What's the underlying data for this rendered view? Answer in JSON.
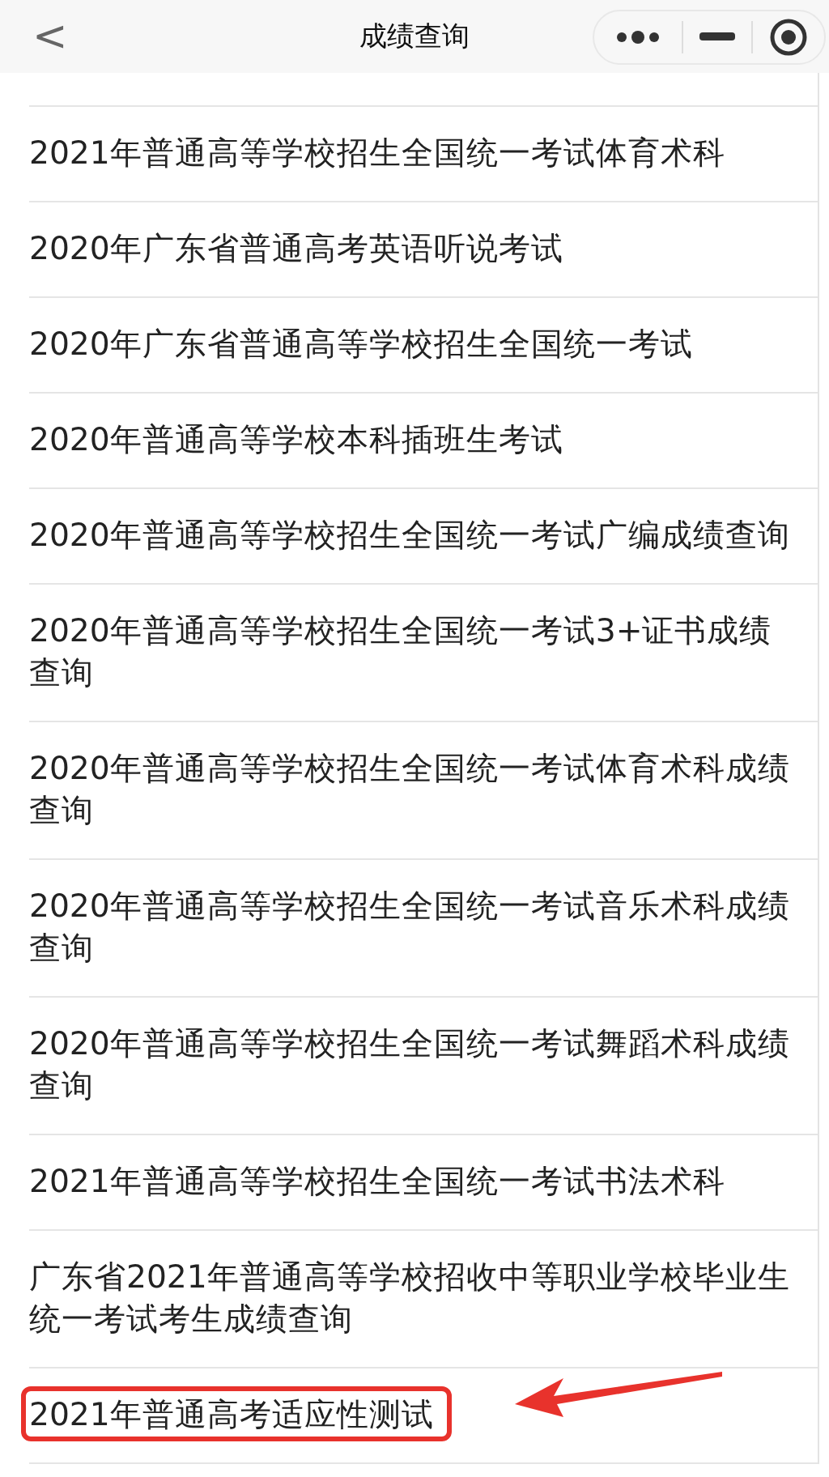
{
  "nav_bar": {
    "back": "<",
    "title": "成绩查询"
  },
  "items": [
    {
      "label": "2021年普通高等学校招生全国统一考试体育术科",
      "highlighted": false
    },
    {
      "label": "2020年广东省普通高考英语听说考试",
      "highlighted": false
    },
    {
      "label": "2020年广东省普通高等学校招生全国统一考试",
      "highlighted": false
    },
    {
      "label": "2020年普通高等学校本科插班生考试",
      "highlighted": false
    },
    {
      "label": "2020年普通高等学校招生全国统一考试广编成绩查询",
      "highlighted": false
    },
    {
      "label": "2020年普通高等学校招生全国统一考试3+证书成绩查询",
      "highlighted": false
    },
    {
      "label": "2020年普通高等学校招生全国统一考试体育术科成绩查询",
      "highlighted": false
    },
    {
      "label": "2020年普通高等学校招生全国统一考试音乐术科成绩查询",
      "highlighted": false
    },
    {
      "label": "2020年普通高等学校招生全国统一考试舞蹈术科成绩查询",
      "highlighted": false
    },
    {
      "label": "2021年普通高等学校招生全国统一考试书法术科",
      "highlighted": false
    },
    {
      "label": "广东省2021年普通高等学校招收中等职业学校毕业生统一考试考生成绩查询",
      "highlighted": false
    },
    {
      "label": "2021年普通高考适应性测试",
      "highlighted": true
    }
  ]
}
